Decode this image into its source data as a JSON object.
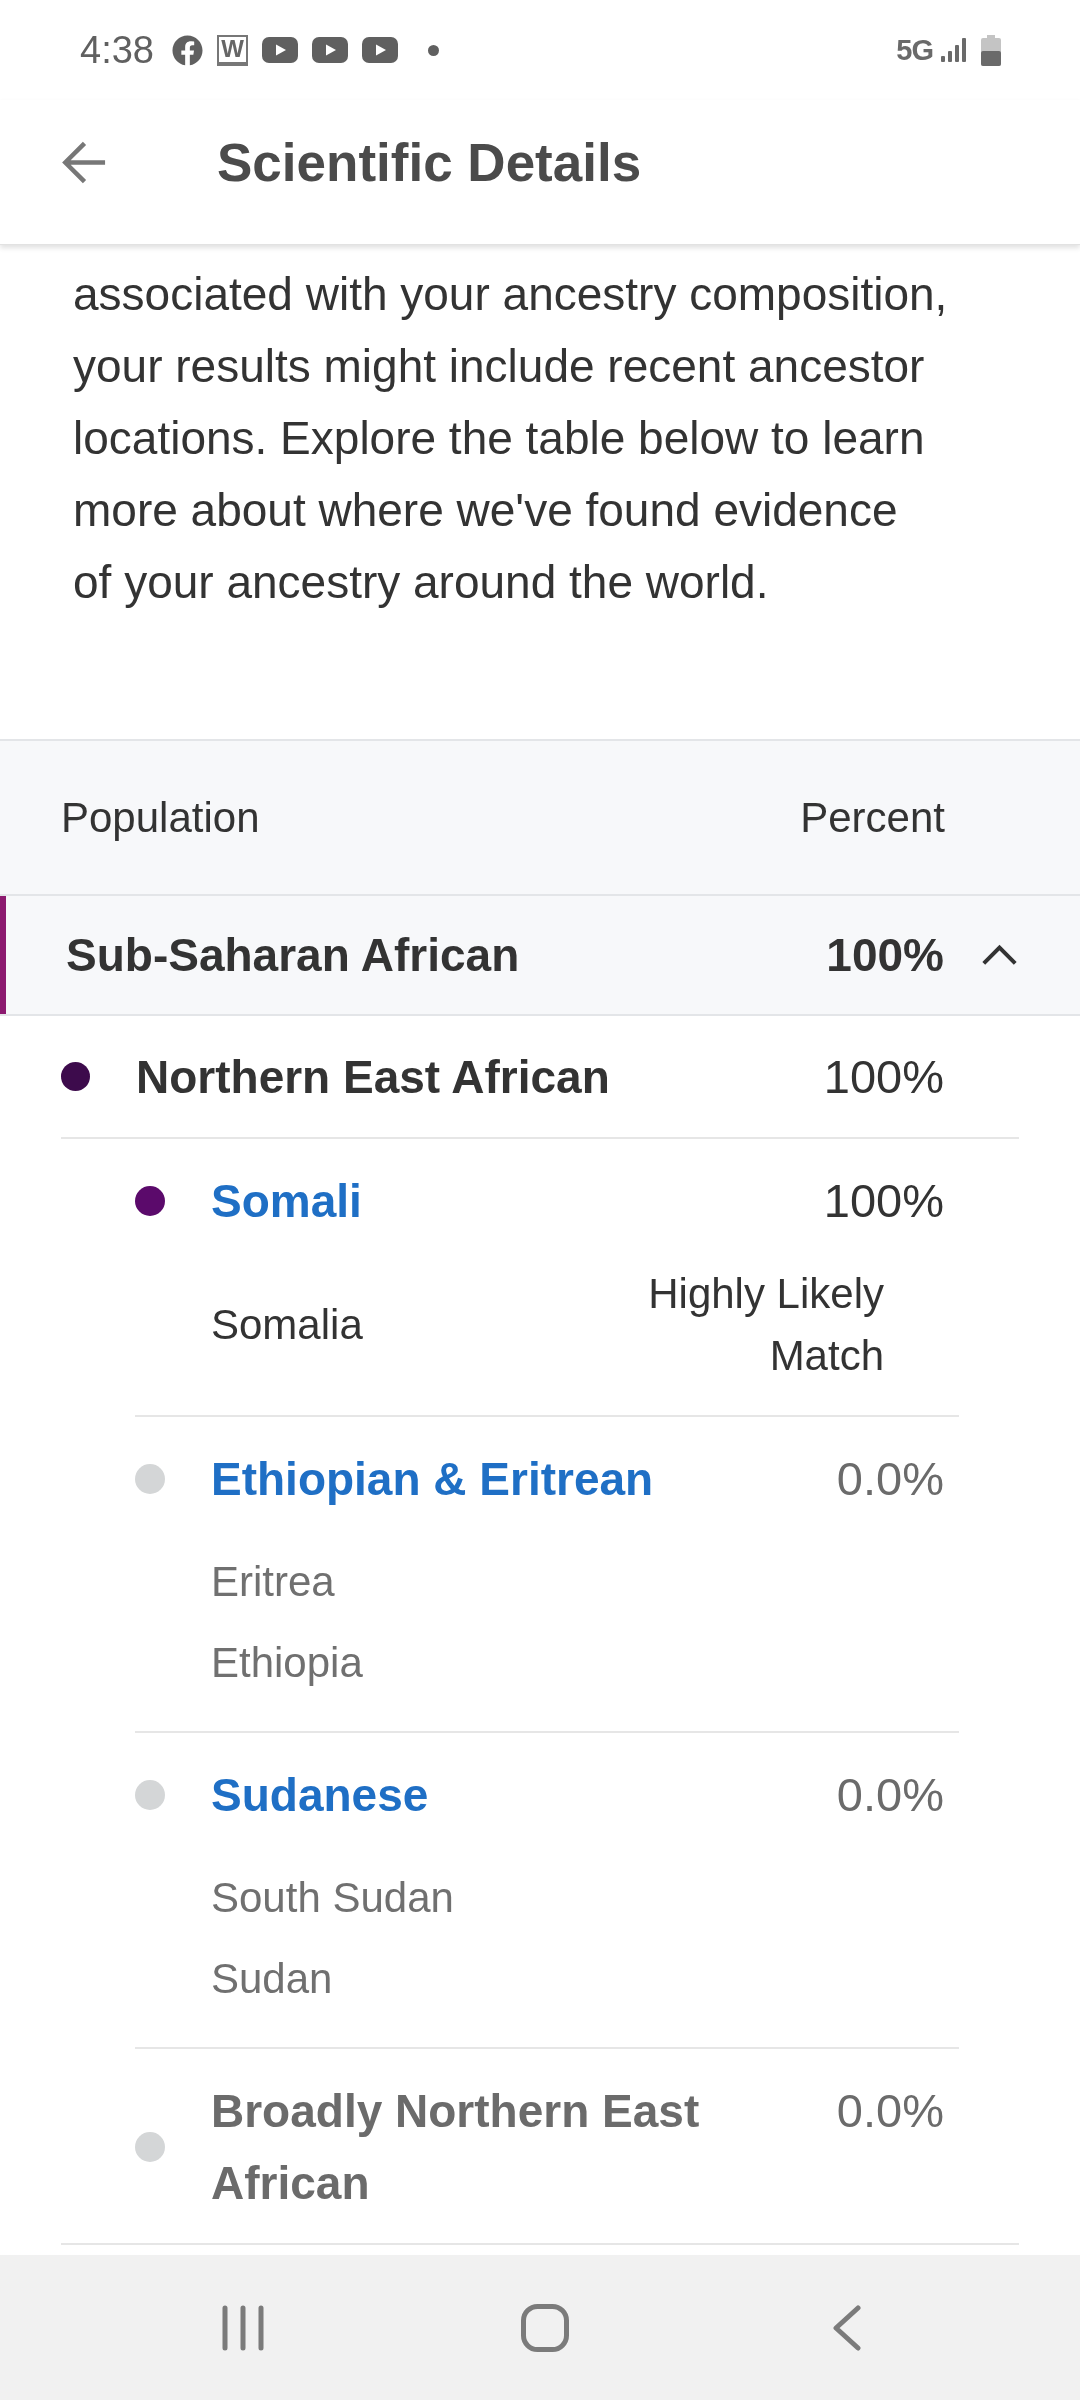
{
  "status_bar": {
    "time": "4:38",
    "app_badge": "W",
    "network": "5G"
  },
  "header": {
    "title": "Scientific Details"
  },
  "intro_lines": [
    "associated with your ancestry composition,",
    "your results might include recent ancestor",
    "locations. Explore the table below to learn",
    "more about where we've found evidence",
    "of your ancestry around the world."
  ],
  "table": {
    "columns": [
      "Population",
      "Percent"
    ],
    "categories": [
      {
        "name": "Sub-Saharan African",
        "percent": "100%",
        "color": "#8c1a6f",
        "expanded": true,
        "children": [
          {
            "name": "Northern East African",
            "percent": "100%",
            "color": "#3d0b4c",
            "children": [
              {
                "name": "Somali",
                "kind": "link",
                "percent": "100%",
                "muted": false,
                "color": "#5b0a6b",
                "locations": [
                  {
                    "name": "Somalia",
                    "match": "Highly Likely Match"
                  }
                ]
              },
              {
                "name": "Ethiopian & Eritrean",
                "kind": "link",
                "percent": "0.0%",
                "muted": true,
                "color": "#d4d6d7",
                "locations": [
                  {
                    "name": "Eritrea"
                  },
                  {
                    "name": "Ethiopia"
                  }
                ]
              },
              {
                "name": "Sudanese",
                "kind": "link",
                "percent": "0.0%",
                "muted": true,
                "color": "#d4d6d7",
                "locations": [
                  {
                    "name": "South Sudan"
                  },
                  {
                    "name": "Sudan"
                  }
                ]
              },
              {
                "name": "Broadly Northern East African",
                "kind": "label",
                "percent": "0.0%",
                "muted": true,
                "color": "#d4d6d7"
              }
            ]
          }
        ]
      }
    ]
  }
}
